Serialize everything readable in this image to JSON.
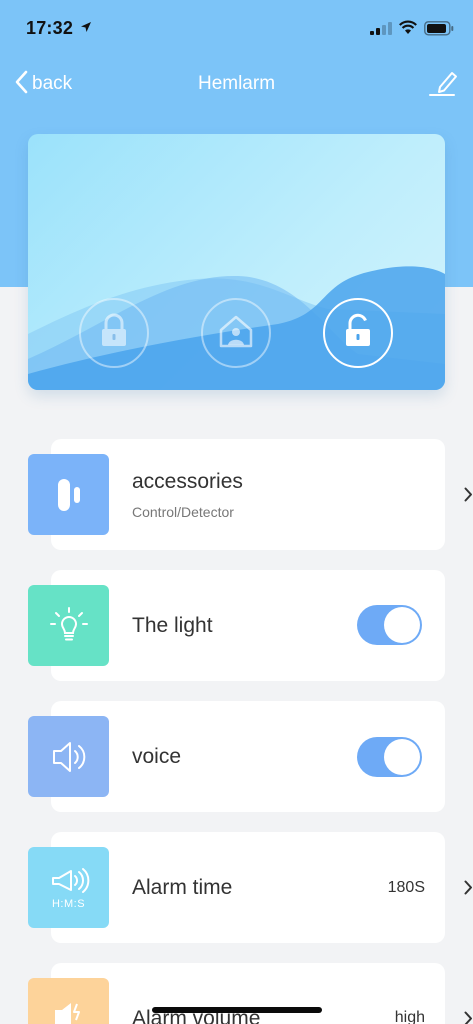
{
  "status": {
    "time": "17:32",
    "icons": [
      "location-arrow-icon",
      "signal-icon",
      "wifi-icon",
      "battery-icon"
    ]
  },
  "nav": {
    "back_label": "back",
    "title": "Hemlarm",
    "edit_icon": "edit-pen-icon"
  },
  "hero": {
    "modes": [
      {
        "name": "arm",
        "icon": "lock-closed-icon",
        "active": false
      },
      {
        "name": "home",
        "icon": "home-user-icon",
        "active": false
      },
      {
        "name": "disarm",
        "icon": "lock-open-icon",
        "active": true
      }
    ]
  },
  "list": {
    "accessories": {
      "title": "accessories",
      "subtitle": "Control/Detector",
      "icon": "door-sensor-icon",
      "color": "#7bb3f9"
    },
    "light": {
      "title": "The light",
      "icon": "light-bulb-icon",
      "color": "#66e2c6",
      "enabled": true
    },
    "voice": {
      "title": "voice",
      "icon": "speaker-icon",
      "color": "#8cb5f4",
      "enabled": true
    },
    "alarm_time": {
      "title": "Alarm time",
      "value": "180S",
      "icon": "megaphone-timer-icon",
      "icon_caption": "H:M:S",
      "color": "#86daf6"
    },
    "alarm_volume": {
      "title": "Alarm volume",
      "value": "high",
      "icon": "volume-icon",
      "color": "#fdd39a"
    }
  },
  "colors": {
    "header": "#7cc4f8",
    "toggle_on": "#6eaaf6",
    "background": "#f2f3f5"
  }
}
